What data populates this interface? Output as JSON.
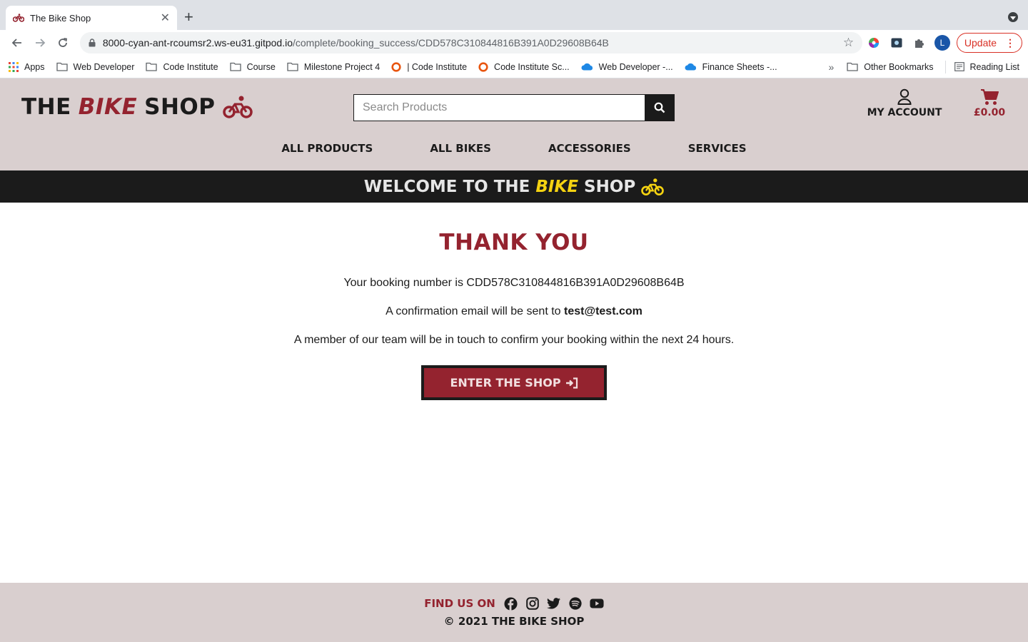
{
  "browser": {
    "tab_title": "The Bike Shop",
    "url_host": "8000-cyan-ant-rcoumsr2.ws-eu31.gitpod.io",
    "url_path": "/complete/booking_success/CDD578C310844816B391A0D29608B64B",
    "profile_initial": "L",
    "update_label": "Update",
    "bookmarks": [
      {
        "label": "Apps",
        "icon": "apps-grid-icon"
      },
      {
        "label": "Web Developer",
        "icon": "folder-icon"
      },
      {
        "label": "Code Institute",
        "icon": "folder-icon"
      },
      {
        "label": "Course",
        "icon": "folder-icon"
      },
      {
        "label": "Milestone Project 4",
        "icon": "folder-icon"
      },
      {
        "label": "| Code Institute",
        "icon": "ring-icon"
      },
      {
        "label": "Code Institute Sc...",
        "icon": "ring-icon"
      },
      {
        "label": "Web Developer -...",
        "icon": "cloud-icon"
      },
      {
        "label": "Finance Sheets -...",
        "icon": "cloud-icon"
      }
    ],
    "bookmarks_overflow": "»",
    "other_bookmarks": "Other Bookmarks",
    "reading_list": "Reading List"
  },
  "header": {
    "logo_part1": "THE",
    "logo_part2": "BIKE",
    "logo_part3": "SHOP",
    "search_placeholder": "Search Products",
    "account_label": "MY ACCOUNT",
    "cart_total": "£0.00",
    "nav": [
      "ALL PRODUCTS",
      "ALL BIKES",
      "ACCESSORIES",
      "SERVICES"
    ]
  },
  "banner": {
    "part1": "WELCOME TO THE",
    "part2": "BIKE",
    "part3": "SHOP"
  },
  "main": {
    "heading": "THANK YOU",
    "booking_prefix": "Your booking number is",
    "booking_number": "CDD578C310844816B391A0D29608B64B",
    "email_prefix": "A confirmation email will be sent to",
    "email": "test@test.com",
    "team_message": "A member of our team will be in touch to confirm your booking within the next 24 hours.",
    "cta_label": "ENTER THE SHOP"
  },
  "footer": {
    "find_us": "FIND US ON",
    "copyright": "© 2021 THE BIKE SHOP"
  },
  "colors": {
    "brand_red": "#94232f",
    "brand_dark": "#1b1b1b",
    "header_bg": "#d9cfcf",
    "banner_accent": "#f5d311"
  }
}
